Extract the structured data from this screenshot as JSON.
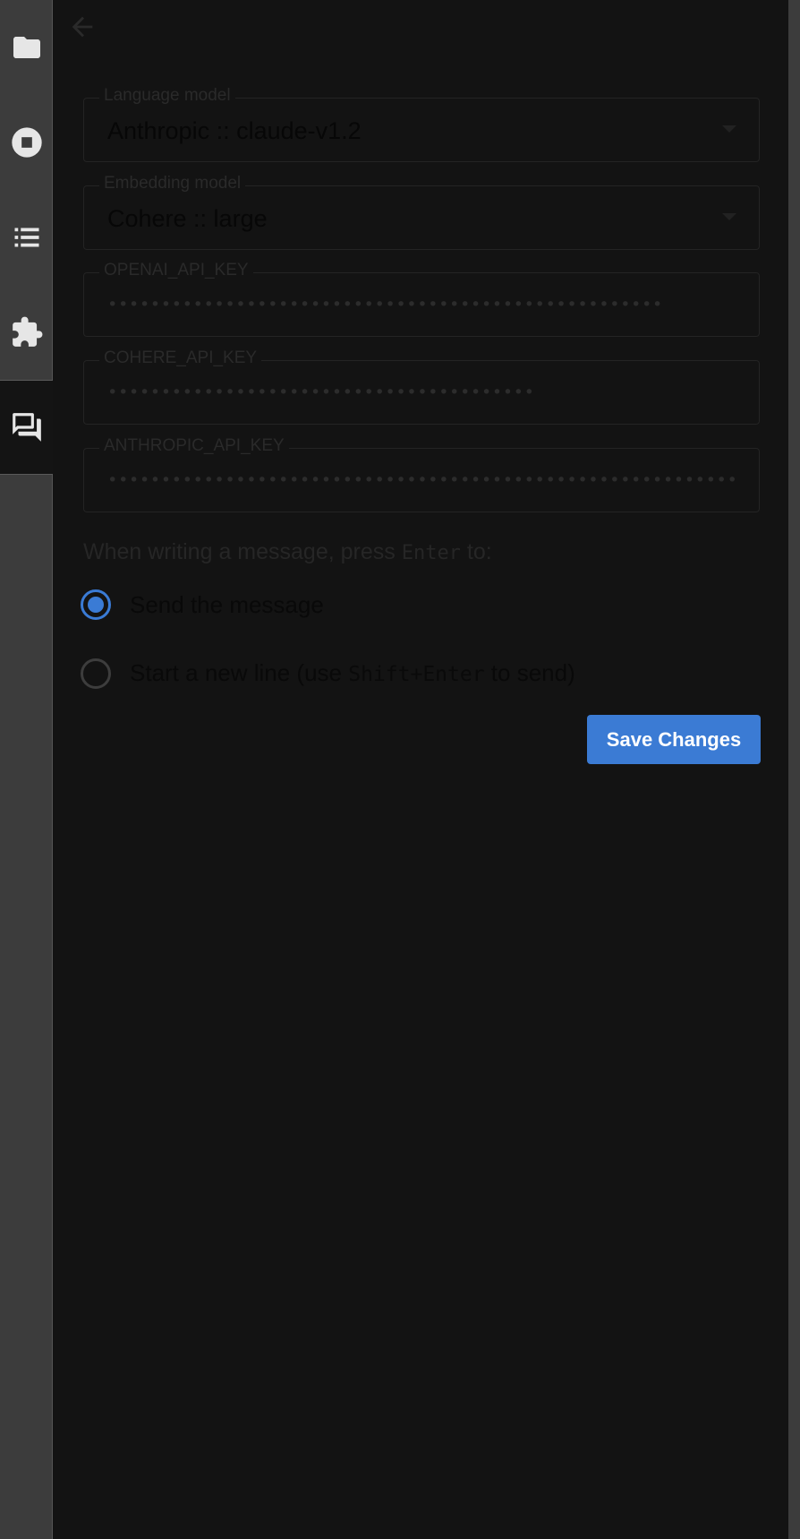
{
  "sidebar": {
    "items": [
      {
        "icon": "folder-icon"
      },
      {
        "icon": "stop-circle-icon"
      },
      {
        "icon": "list-icon"
      },
      {
        "icon": "puzzle-icon"
      },
      {
        "icon": "chat-icon",
        "active": true
      }
    ]
  },
  "header": {
    "back_icon": "arrow-left-icon"
  },
  "settings": {
    "language_model": {
      "label": "Language model",
      "value": "Anthropic :: claude-v1.2"
    },
    "embedding_model": {
      "label": "Embedding model",
      "value": "Cohere :: large"
    },
    "api_keys": [
      {
        "label": "OPENAI_API_KEY",
        "value": "••••••••••••••••••••••••••••••••••••••••••••••••••••"
      },
      {
        "label": "COHERE_API_KEY",
        "value": "••••••••••••••••••••••••••••••••••••••••"
      },
      {
        "label": "ANTHROPIC_API_KEY",
        "value": "•••••••••••••••••••••••••••••••••••••••••••••••••••••••••••••"
      }
    ],
    "enter_behavior": {
      "prompt_before": "When writing a message, press ",
      "prompt_key": "Enter",
      "prompt_after": " to:",
      "options": [
        {
          "label": "Send the message",
          "checked": true
        },
        {
          "label_before": "Start a new line (use ",
          "label_key": "Shift+Enter",
          "label_after": " to send)",
          "checked": false
        }
      ]
    },
    "save_label": "Save Changes"
  },
  "colors": {
    "accent": "#3b7bd4",
    "sidebar_bg": "#3c3c3c",
    "main_bg": "#131313"
  }
}
